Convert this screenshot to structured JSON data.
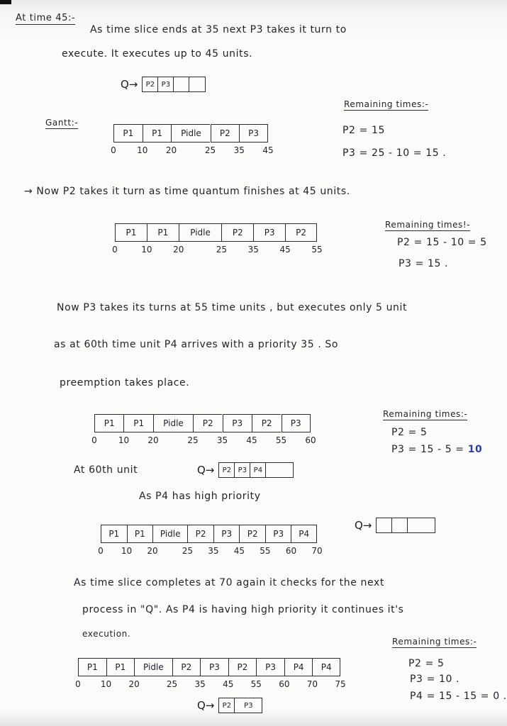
{
  "section_title": "At time 45:-",
  "intro": {
    "line1": "As time slice ends at 35 next P3 takes it turn to",
    "line2": "execute. It executes up to 45 units."
  },
  "queue_1": {
    "label": "Q→",
    "items": [
      "P2",
      "P3",
      "",
      ""
    ]
  },
  "gantt_label": "Gantt:-",
  "gantt_1": {
    "cells": [
      {
        "p": "P1",
        "start": 0,
        "end": 10
      },
      {
        "p": "P1",
        "start": 10,
        "end": 20
      },
      {
        "p": "Pidle",
        "start": 20,
        "end": 25
      },
      {
        "p": "P2",
        "start": 25,
        "end": 35
      },
      {
        "p": "P3",
        "start": 35,
        "end": 45
      }
    ],
    "ticks": [
      "0",
      "10",
      "20",
      "25",
      "35",
      "45"
    ]
  },
  "remaining_1": {
    "title": "Remaining times:-",
    "lines": [
      "P2 = 15",
      "P3 = 25 - 10 = 15 ."
    ]
  },
  "para_2": "→ Now P2 takes it turn as time quantum finishes at 45 units.",
  "gantt_2": {
    "cells": [
      {
        "p": "P1",
        "start": 0,
        "end": 10
      },
      {
        "p": "P1",
        "start": 10,
        "end": 20
      },
      {
        "p": "Pidle",
        "start": 20,
        "end": 25
      },
      {
        "p": "P2",
        "start": 25,
        "end": 35
      },
      {
        "p": "P3",
        "start": 35,
        "end": 45
      },
      {
        "p": "P2",
        "start": 45,
        "end": 55
      }
    ],
    "ticks": [
      "0",
      "10",
      "20",
      "25",
      "35",
      "45",
      "55"
    ]
  },
  "remaining_2": {
    "title": "Remaining times!-",
    "lines": [
      "P2 = 15 - 10 = 5",
      "P3 = 15 ."
    ]
  },
  "para_3": {
    "line1": "Now P3 takes its turns at 55 time units , but executes only 5 unit",
    "line2": "as at 60th time unit P4 arrives with a priority 35 . So",
    "line3": "preemption takes place."
  },
  "gantt_3": {
    "cells": [
      {
        "p": "P1",
        "start": 0,
        "end": 10
      },
      {
        "p": "P1",
        "start": 10,
        "end": 20
      },
      {
        "p": "Pidle",
        "start": 20,
        "end": 25
      },
      {
        "p": "P2",
        "start": 25,
        "end": 35
      },
      {
        "p": "P3",
        "start": 35,
        "end": 45
      },
      {
        "p": "P2",
        "start": 45,
        "end": 55
      },
      {
        "p": "P3",
        "start": 55,
        "end": 60
      }
    ],
    "ticks": [
      "0",
      "10",
      "20",
      "25",
      "35",
      "45",
      "55",
      "60"
    ]
  },
  "remaining_3": {
    "title": "Remaining times:-",
    "line_p2": "P2 = 5",
    "line_p3_prefix": "P3 = 15 - 5 =",
    "line_p3_value": "10"
  },
  "at_60": {
    "label": "At 60th unit"
  },
  "queue_2": {
    "label": "Q→",
    "items": [
      "P2",
      "P3",
      "P4",
      ""
    ]
  },
  "p4_priority_note": "As P4 has high priority",
  "gantt_4": {
    "cells": [
      {
        "p": "P1",
        "start": 0,
        "end": 10
      },
      {
        "p": "P1",
        "start": 10,
        "end": 20
      },
      {
        "p": "Pidle",
        "start": 20,
        "end": 25
      },
      {
        "p": "P2",
        "start": 25,
        "end": 35
      },
      {
        "p": "P3",
        "start": 35,
        "end": 45
      },
      {
        "p": "P2",
        "start": 45,
        "end": 55
      },
      {
        "p": "P3",
        "start": 55,
        "end": 60
      },
      {
        "p": "P4",
        "start": 60,
        "end": 70
      }
    ],
    "ticks": [
      "0",
      "10",
      "20",
      "25",
      "35",
      "45",
      "55",
      "60",
      "70"
    ]
  },
  "queue_3": {
    "label": "Q→",
    "items": [
      "",
      "",
      ""
    ]
  },
  "para_4": {
    "line1": "As time slice completes at 70 again it checks for the next",
    "line2": "process in \"Q\". As P4 is having high priority it continues it's",
    "line3": "execution."
  },
  "gantt_5": {
    "cells": [
      {
        "p": "P1",
        "start": 0,
        "end": 10
      },
      {
        "p": "P1",
        "start": 10,
        "end": 20
      },
      {
        "p": "Pidle",
        "start": 20,
        "end": 25
      },
      {
        "p": "P2",
        "start": 25,
        "end": 35
      },
      {
        "p": "P3",
        "start": 35,
        "end": 45
      },
      {
        "p": "P2",
        "start": 45,
        "end": 55
      },
      {
        "p": "P3",
        "start": 55,
        "end": 60
      },
      {
        "p": "P4",
        "start": 60,
        "end": 70
      },
      {
        "p": "P4",
        "start": 70,
        "end": 75
      }
    ],
    "ticks": [
      "0",
      "10",
      "20",
      "25",
      "35",
      "45",
      "55",
      "60",
      "70",
      "75"
    ]
  },
  "remaining_4": {
    "title": "Remaining times:-",
    "lines": [
      "P2 = 5",
      "P3 = 10 .",
      "P4 = 15 - 15 = 0 ."
    ]
  },
  "queue_4": {
    "label": "Q→",
    "items": [
      "P2",
      "P3"
    ]
  }
}
